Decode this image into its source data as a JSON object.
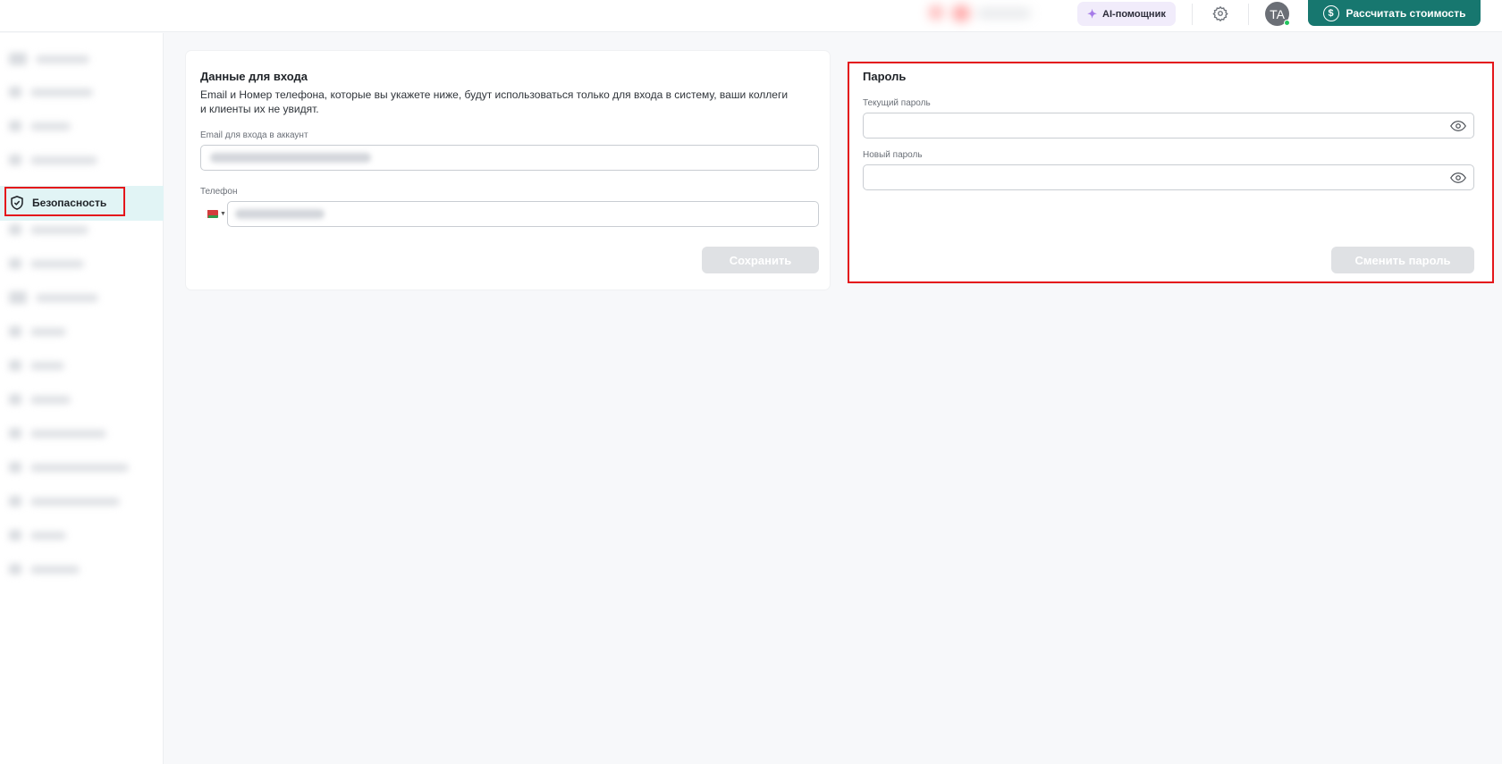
{
  "header": {
    "ai_assistant_label": "AI-помощник",
    "ai_icon": "sparkles-icon",
    "settings_icon": "gear-icon",
    "avatar_initials": "TA",
    "calculate_button_label": "Рассчитать стоимость",
    "calculate_icon": "dollar-coin-icon",
    "accent_color": "#17776f"
  },
  "sidebar": {
    "active_item": {
      "label": "Безопасность",
      "icon": "shield-check-icon",
      "highlight_color": "#e1f4f5"
    }
  },
  "login_card": {
    "title": "Данные для входа",
    "description": "Email и Номер телефона, которые вы укажете ниже, будут использоваться только для входа в систему, ваши коллеги и клиенты их не увидят.",
    "email_label": "Email для входа в аккаунт",
    "phone_label": "Телефон",
    "phone_country_icon": "belarus-flag-icon",
    "save_button_label": "Сохранить"
  },
  "password_card": {
    "title": "Пароль",
    "current_password_label": "Текущий пароль",
    "new_password_label": "Новый пароль",
    "show_password_icon": "eye-icon",
    "change_button_label": "Сменить пароль"
  },
  "highlight_color": "#e4161b"
}
